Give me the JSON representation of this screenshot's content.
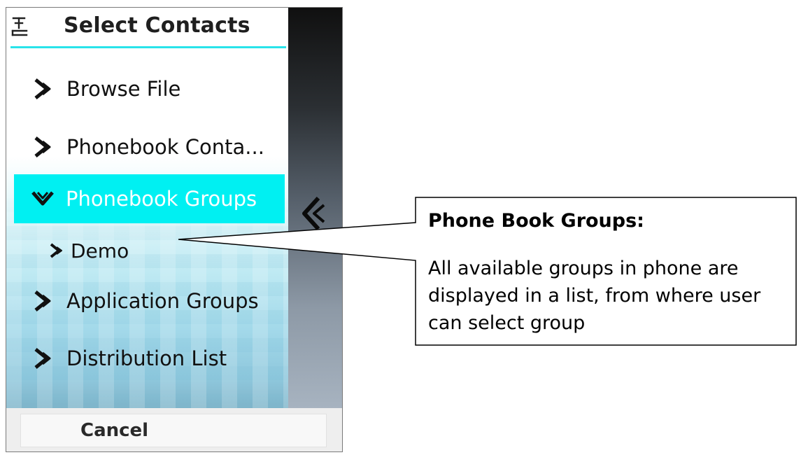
{
  "header": {
    "title": "Select Contacts",
    "icon": "signal-icon"
  },
  "menu": {
    "items": [
      {
        "label": "Browse File",
        "icon": "chevron-right-icon",
        "selected": false
      },
      {
        "label": "Phonebook Conta...",
        "icon": "chevron-right-icon",
        "selected": false
      },
      {
        "label": "Phonebook Groups",
        "icon": "chevron-down-icon",
        "selected": true
      },
      {
        "label": "Demo",
        "icon": "chevron-right-icon",
        "selected": false,
        "subitem": true
      },
      {
        "label": "Application Groups",
        "icon": "chevron-right-icon",
        "selected": false
      },
      {
        "label": "Distribution List",
        "icon": "chevron-right-icon",
        "selected": false
      }
    ]
  },
  "softkeys": {
    "cancel_label": "Cancel"
  },
  "callout": {
    "title": "Phone Book Groups:",
    "body": "All available groups in phone are displayed in a list, from where user can select group"
  },
  "colors": {
    "accent": "#00f0f2",
    "title_underline": "#29e3ea"
  }
}
